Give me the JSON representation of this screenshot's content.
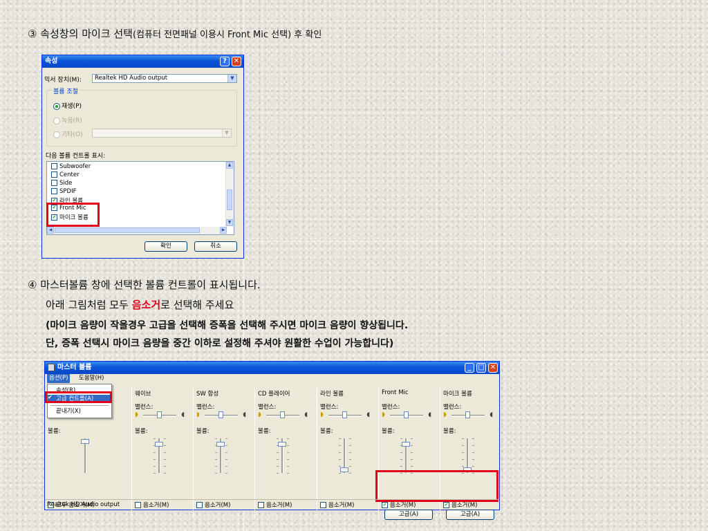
{
  "step3": {
    "num": "③",
    "text": " 속성창의 마이크 선택",
    "paren": "(컴퓨터 전면패널 이용시 Front Mic 선택) 후 확인"
  },
  "props_window": {
    "title": "속성",
    "mixer_device_label": "믹서 장치(M):",
    "mixer_device_value": "Realtek HD Audio output",
    "volume_group_label": "볼륨 조절",
    "radio_playback": "재생(P)",
    "radio_record": "녹음(R)",
    "radio_other": "기타(O)",
    "show_controls_label": "다음 볼륨 컨트롤 표시:",
    "items": [
      {
        "label": "Subwoofer",
        "checked": false
      },
      {
        "label": "Center",
        "checked": false
      },
      {
        "label": "Side",
        "checked": false
      },
      {
        "label": "SPDIF",
        "checked": false
      },
      {
        "label": "라인 볼륨",
        "checked": true
      },
      {
        "label": "Front Mic",
        "checked": true
      },
      {
        "label": "마이크 볼륨",
        "checked": true
      }
    ],
    "ok_button": "확인",
    "cancel_button": "취소"
  },
  "step4": {
    "num": "④",
    "line1": " 마스터볼륨 창에 선택한 볼륨 컨트롤이 표시됩니다.",
    "line2_pre": "아래 그림처럼 모두 ",
    "line2_red": "음소거",
    "line2_post": "로 선택해 주세요",
    "line3": "(마이크 음량이 작을경우 고급을 선택해 증폭을 선택해 주시면 마이크 음량이 향상됩니다.",
    "line4": "단, 증폭 선택시 마이크 음량을 중간 이하로 설정해 주셔야 원활한 수업이 가능합니다)"
  },
  "mixer_window": {
    "title": "마스터 볼륨",
    "menu_options": "옵션(P)",
    "menu_help": "도움말(H)",
    "dropdown": [
      "속성(R)",
      "고급 컨트롤(A)",
      "끝내기(X)"
    ],
    "balance_label": "밸런스:",
    "volume_label": "볼륨:",
    "mute_all_label": "모두 음소거(M)",
    "mute_label": "음소거(M)",
    "advanced_button": "고급(A)",
    "columns": [
      {
        "name": "웨이브",
        "muted": false,
        "level": 0.85
      },
      {
        "name": "SW 합성",
        "muted": false,
        "level": 0.85
      },
      {
        "name": "CD 플레이어",
        "muted": false,
        "level": 0.85
      },
      {
        "name": "라인 볼륨",
        "muted": false,
        "level": 0.1
      },
      {
        "name": "Front Mic",
        "muted": true,
        "level": 0.85
      },
      {
        "name": "마이크 볼륨",
        "muted": true,
        "level": 0.1
      }
    ],
    "status": "Realtek HD Audio output"
  }
}
